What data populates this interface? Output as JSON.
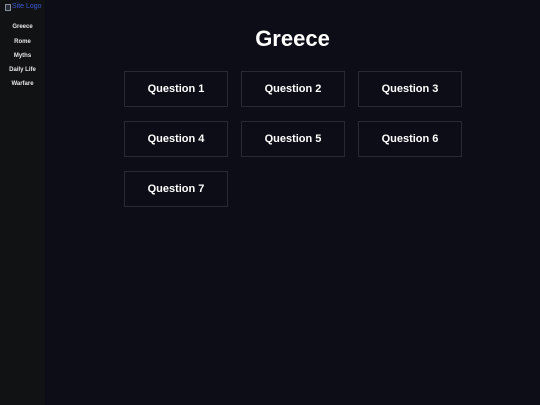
{
  "sidebar": {
    "logo_alt": "Site Logo",
    "items": [
      {
        "label": "Greece"
      },
      {
        "label": "Rome"
      },
      {
        "label": "Myths"
      },
      {
        "label": "Daily Life"
      },
      {
        "label": "Warfare"
      }
    ]
  },
  "main": {
    "title": "Greece",
    "questions": [
      {
        "label": "Question 1"
      },
      {
        "label": "Question 2"
      },
      {
        "label": "Question 3"
      },
      {
        "label": "Question 4"
      },
      {
        "label": "Question 5"
      },
      {
        "label": "Question 6"
      },
      {
        "label": "Question 7"
      }
    ]
  },
  "colors": {
    "background": "#0c0d16",
    "sidebar": "#111214",
    "card_border": "#272a33",
    "text": "#ffffff",
    "logo_link": "#3b5bd6"
  }
}
